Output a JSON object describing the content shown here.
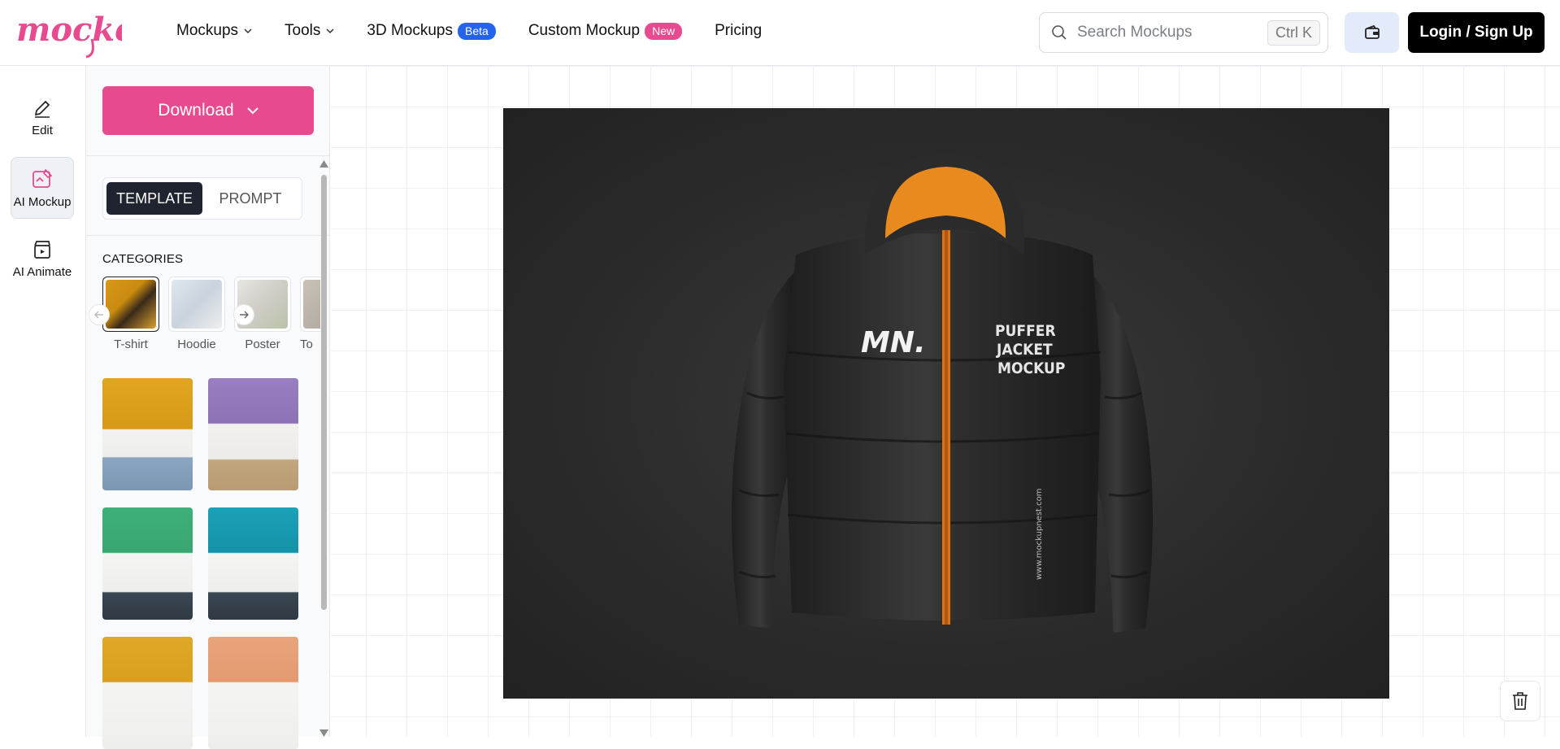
{
  "brand": {
    "logo_text": "mockey",
    "color": "#e84a8f"
  },
  "nav": {
    "mockups": "Mockups",
    "tools": "Tools",
    "mockups_3d": "3D Mockups",
    "beta_badge": "Beta",
    "custom": "Custom Mockup",
    "new_badge": "New",
    "pricing": "Pricing"
  },
  "search": {
    "placeholder": "Search Mockups",
    "shortcut": "Ctrl K"
  },
  "header": {
    "login_label": "Login / Sign Up"
  },
  "rail": {
    "items": [
      {
        "label": "Edit",
        "icon": "pencil-icon"
      },
      {
        "label": "AI Mockup",
        "icon": "image-edit-icon"
      },
      {
        "label": "AI Animate",
        "icon": "video-clip-icon"
      }
    ]
  },
  "panel": {
    "download_label": "Download",
    "tabs": [
      "TEMPLATE",
      "PROMPT"
    ],
    "categories_title": "CATEGORIES",
    "categories": [
      "T-shirt",
      "Hoodie",
      "Poster",
      "To"
    ]
  },
  "mockup": {
    "logo_mark": "MN.",
    "print_text": [
      "PUFFER",
      "JACKET",
      "MOCKUP"
    ],
    "side_text": "www.mockupnest.com",
    "colors": {
      "jacket": "#2f2f2f",
      "lining": "#e88a1e",
      "zipper": "#d9731a"
    }
  }
}
